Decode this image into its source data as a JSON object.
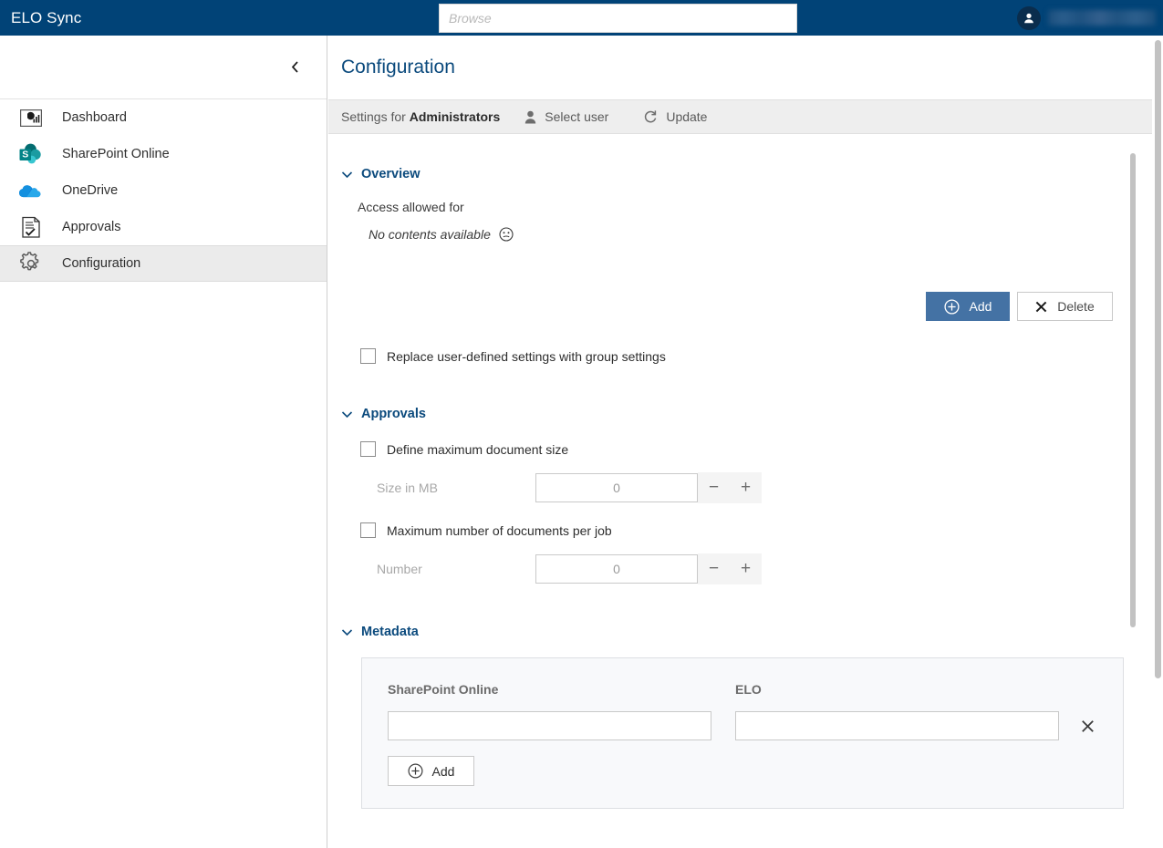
{
  "app": {
    "title": "ELO Sync",
    "accent_blue": "#014377",
    "primary_button": "#4472a4",
    "link_blue": "#0b4a7d"
  },
  "search": {
    "placeholder": "Browse",
    "value": ""
  },
  "user": {
    "name": "",
    "avatar_icon": "user-icon"
  },
  "sidebar": {
    "collapse_icon": "chevron-left-icon",
    "items": [
      {
        "label": "Dashboard",
        "icon": "dashboard-chart-icon",
        "selected": false
      },
      {
        "label": "SharePoint Online",
        "icon": "sharepoint-icon",
        "selected": false
      },
      {
        "label": "OneDrive",
        "icon": "onedrive-cloud-icon",
        "selected": false
      },
      {
        "label": "Approvals",
        "icon": "document-check-icon",
        "selected": false
      },
      {
        "label": "Configuration",
        "icon": "gear-icon",
        "selected": true
      }
    ]
  },
  "page": {
    "title": "Configuration"
  },
  "toolbar": {
    "settings_for_prefix": "Settings for ",
    "settings_for_group": "Administrators",
    "select_user_label": "Select user",
    "select_user_icon": "person-icon",
    "update_label": "Update",
    "update_icon": "refresh-icon"
  },
  "sections": {
    "overview": {
      "title": "Overview",
      "chevron_icon": "chevron-down-icon",
      "access_label": "Access allowed for",
      "empty_text": "No contents available",
      "empty_icon": "neutral-face-icon",
      "add_label": "Add",
      "add_icon": "plus-circle-icon",
      "delete_label": "Delete",
      "delete_icon": "close-x-icon",
      "replace_checkbox_label": "Replace user-defined settings with group settings",
      "replace_checkbox_checked": false
    },
    "approvals": {
      "title": "Approvals",
      "chevron_icon": "chevron-down-icon",
      "max_size_checkbox_label": "Define maximum document size",
      "max_size_checkbox_checked": false,
      "size_label": "Size in MB",
      "size_value": "0",
      "max_docs_checkbox_label": "Maximum number of documents per job",
      "max_docs_checkbox_checked": false,
      "number_label": "Number",
      "number_value": "0",
      "minus_icon": "minus-icon",
      "plus_icon": "plus-icon"
    },
    "metadata": {
      "title": "Metadata",
      "chevron_icon": "chevron-down-icon",
      "col_sharepoint": "SharePoint Online",
      "col_elo": "ELO",
      "row_sharepoint_value": "",
      "row_elo_value": "",
      "remove_icon": "close-x-icon",
      "add_label": "Add",
      "add_icon": "plus-circle-icon"
    }
  }
}
